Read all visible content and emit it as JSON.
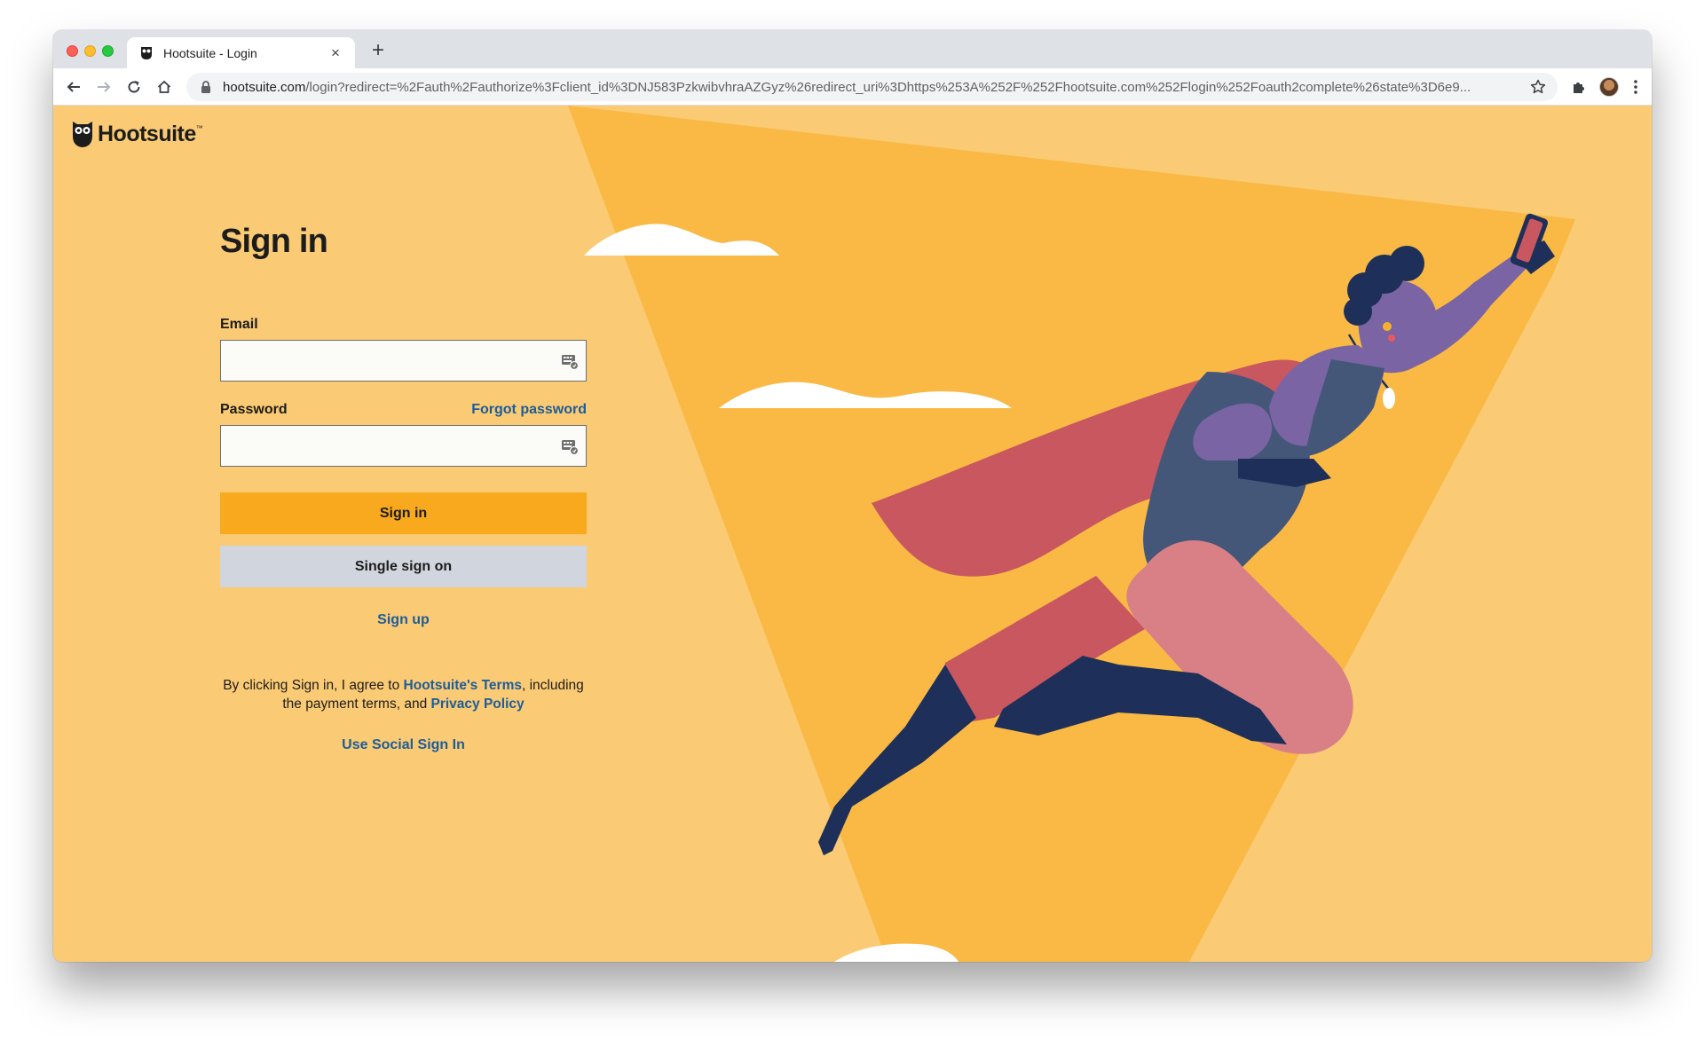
{
  "browser": {
    "tab_title": "Hootsuite - Login",
    "new_tab_label": "+",
    "url_host": "hootsuite.com",
    "url_path": "/login?redirect=%2Fauth%2Fauthorize%3Fclient_id%3DNJ583PzkwibvhraAZGyz%26redirect_uri%3Dhttps%253A%252F%252Fhootsuite.com%252Flogin%252Foauth2complete%26state%3D6e9..."
  },
  "page": {
    "brand": "Hootsuite",
    "brand_mark": "™",
    "heading": "Sign in",
    "email_label": "Email",
    "email_value": "",
    "password_label": "Password",
    "password_value": "",
    "forgot_password": "Forgot password",
    "signin_button": "Sign in",
    "sso_button": "Single sign on",
    "signup_link": "Sign up",
    "legal": {
      "prefix": "By clicking Sign in, I agree to ",
      "terms_link": "Hootsuite's Terms",
      "middle": ", including the payment terms, and ",
      "privacy_link": "Privacy Policy"
    },
    "social_signin_link": "Use Social Sign In"
  },
  "colors": {
    "background": "#fbca74",
    "spotlight": "#f9b944",
    "primary_button": "#f8a91e",
    "secondary_button": "#d1d5de",
    "link": "#1c5d99",
    "cape": "#c8575f",
    "suit": "#445779",
    "skin": "#7a64a4",
    "boots": "#1e3059"
  }
}
